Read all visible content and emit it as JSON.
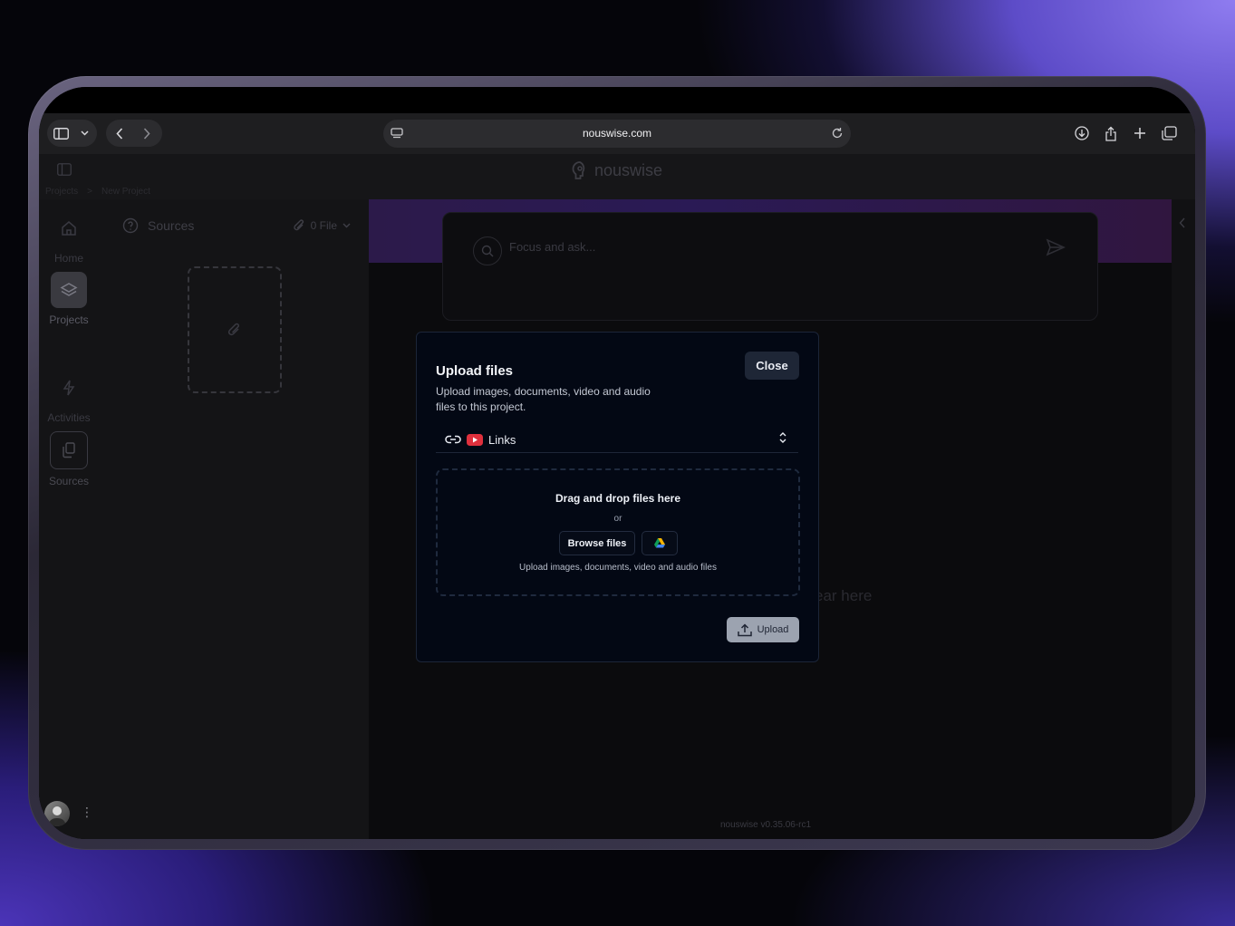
{
  "browser": {
    "url": "nouswise.com"
  },
  "app": {
    "logo_text": "nouswise",
    "breadcrumbs": [
      "Projects",
      ">",
      "New Project"
    ],
    "rail": [
      {
        "label": "Home",
        "icon": "home-icon"
      },
      {
        "label": "Projects",
        "icon": "layers-icon",
        "active": true
      },
      {
        "label": "Activities",
        "icon": "bolt-icon"
      },
      {
        "label": "Sources",
        "icon": "copy-icon"
      }
    ],
    "sources_panel": {
      "title": "Sources",
      "file_count": "0 File"
    },
    "ask": {
      "placeholder": "Focus and ask..."
    },
    "empty_hint": "ear here",
    "version": "nouswise v0.35.06-rc1"
  },
  "modal": {
    "title": "Upload files",
    "description": "Upload images, documents, video and audio files to this project.",
    "close_label": "Close",
    "source_select": {
      "selected": "Links"
    },
    "dropzone": {
      "heading": "Drag and drop files here",
      "or": "or",
      "browse_label": "Browse files",
      "hint": "Upload images, documents, video and audio files"
    },
    "upload_label": "Upload"
  },
  "colors": {
    "accent_youtube": "#e0303d",
    "modal_bg": "#030814"
  }
}
